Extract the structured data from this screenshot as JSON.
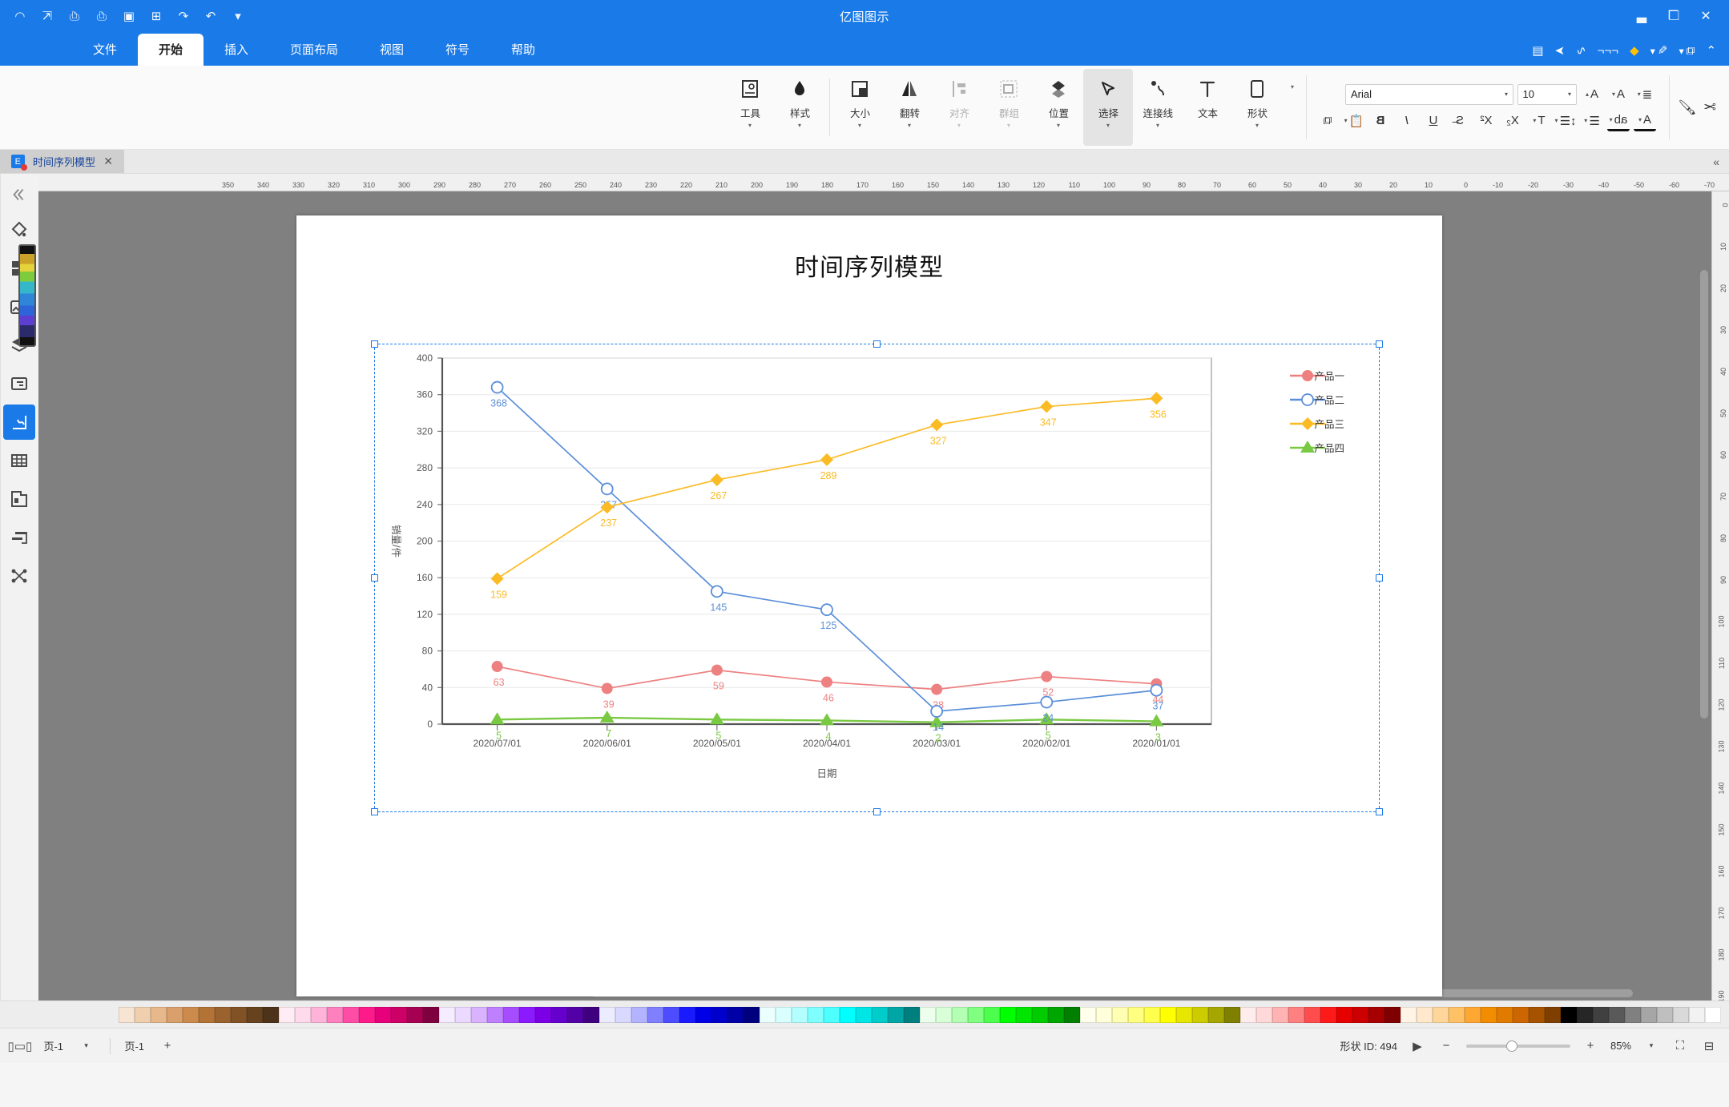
{
  "app": {
    "window_title": "亿图图示",
    "titlebar_icons": [
      "close-icon",
      "restore-icon",
      "minimize-icon"
    ],
    "quick_access_icons": [
      "undo-icon",
      "redo-icon",
      "save-icon",
      "new-icon",
      "open-icon",
      "print-icon",
      "export-icon",
      "more-icon"
    ],
    "quick_toolbar_icons": [
      "select-tool-icon",
      "pen-tool-icon",
      "highlighter-icon",
      "text-tool-icon",
      "connector-icon",
      "pointer-icon",
      "note-icon"
    ]
  },
  "ribbon": {
    "tabs": [
      {
        "label": "文件",
        "active": false
      },
      {
        "label": "开始",
        "active": true
      },
      {
        "label": "插入",
        "active": false
      },
      {
        "label": "页面布局",
        "active": false
      },
      {
        "label": "视图",
        "active": false
      },
      {
        "label": "符号",
        "active": false
      },
      {
        "label": "帮助",
        "active": false
      }
    ],
    "groups": [
      {
        "label": "形状",
        "icon": "shape-icon",
        "active": false,
        "dim": false
      },
      {
        "label": "文本",
        "icon": "text-icon",
        "active": false,
        "dim": false
      },
      {
        "label": "连接线",
        "icon": "connector-icon",
        "active": false,
        "dim": false
      },
      {
        "label": "选择",
        "icon": "select-arrow-icon",
        "active": true,
        "dim": false
      },
      {
        "label": "位置",
        "icon": "position-icon",
        "active": false,
        "dim": false
      },
      {
        "label": "群组",
        "icon": "group-icon",
        "active": false,
        "dim": true
      },
      {
        "label": "对齐",
        "icon": "align-icon",
        "active": false,
        "dim": true
      },
      {
        "label": "翻转",
        "icon": "flip-icon",
        "active": false,
        "dim": false
      },
      {
        "label": "大小",
        "icon": "size-icon",
        "active": false,
        "dim": false
      },
      {
        "label": "样式",
        "icon": "style-icon",
        "active": false,
        "dim": false
      },
      {
        "label": "工具",
        "icon": "tools-icon",
        "active": false,
        "dim": false
      }
    ],
    "font": {
      "family_value": "Arial",
      "size_value": "10",
      "row1_icons": [
        "cut-icon",
        "format-painter-icon",
        "grow-font-icon",
        "shrink-font-icon",
        "text-align-icon"
      ],
      "row2_icons": [
        "copy-icon",
        "paste-icon",
        "bold-icon",
        "italic-icon",
        "underline-icon",
        "strikethrough-icon",
        "superscript-icon",
        "subscript-icon",
        "text-case-icon",
        "line-spacing-icon",
        "bullet-list-icon",
        "highlight-color-icon",
        "font-color-icon"
      ]
    }
  },
  "document_tab": {
    "name": "时间序列模型",
    "icon": "edraw-icon",
    "close_label": "✕",
    "collapse_label": "«"
  },
  "left_rail": {
    "items": [
      {
        "name": "expand-panel",
        "icon": "chevron-right-double-icon",
        "active": false
      },
      {
        "name": "fill-style",
        "icon": "paint-bucket-icon",
        "active": false
      },
      {
        "name": "shape-library",
        "icon": "grid-shapes-icon",
        "active": false
      },
      {
        "name": "image",
        "icon": "picture-icon",
        "active": false
      },
      {
        "name": "layers",
        "icon": "layers-icon",
        "active": false
      },
      {
        "name": "notes",
        "icon": "note-card-icon",
        "active": false
      },
      {
        "name": "chart",
        "icon": "chart-icon",
        "active": true
      },
      {
        "name": "table",
        "icon": "table-icon",
        "active": false
      },
      {
        "name": "floorplan",
        "icon": "floorplan-icon",
        "active": false
      },
      {
        "name": "gantt",
        "icon": "gantt-icon",
        "active": false
      },
      {
        "name": "mindmap",
        "icon": "mindmap-icon",
        "active": false
      }
    ]
  },
  "ruler": {
    "h_ticks": [
      "-70",
      "-60",
      "-50",
      "-40",
      "-30",
      "-20",
      "-10",
      "0",
      "10",
      "20",
      "30",
      "40",
      "50",
      "60",
      "70",
      "80",
      "90",
      "100",
      "110",
      "120",
      "130",
      "140",
      "150",
      "160",
      "170",
      "180",
      "190",
      "200",
      "210",
      "220",
      "230",
      "240",
      "250",
      "260",
      "270",
      "280",
      "290",
      "300",
      "310",
      "320",
      "330",
      "340",
      "350"
    ],
    "v_ticks": [
      "0",
      "10",
      "20",
      "30",
      "40",
      "50",
      "60",
      "70",
      "80",
      "90",
      "100",
      "110",
      "120",
      "130",
      "140",
      "150",
      "160",
      "170",
      "180",
      "190"
    ]
  },
  "status_bar": {
    "shape_id_label": "形状 ID: 494",
    "zoom_value": "85%",
    "page_label": "页-1",
    "page_selector_label": "页-1",
    "add_page_label": "+",
    "minus_label": "−",
    "plus_label": "+",
    "fit_icon": "fit-width-icon",
    "fullscreen_icon": "fullscreen-icon",
    "presentation_icon": "presentation-icon",
    "back-icon": "back-circle-icon"
  },
  "palette": {
    "colors": [
      "#ffffff",
      "#f2f2f2",
      "#d9d9d9",
      "#bfbfbf",
      "#a6a6a6",
      "#808080",
      "#595959",
      "#404040",
      "#262626",
      "#000000",
      "#7f3f00",
      "#a65300",
      "#cc6600",
      "#e07b00",
      "#f28c00",
      "#ffa733",
      "#ffc166",
      "#ffd699",
      "#ffe8cc",
      "#fff4e6",
      "#7f0000",
      "#a60000",
      "#cc0000",
      "#e60000",
      "#ff1a1a",
      "#ff4d4d",
      "#ff8080",
      "#ffb3b3",
      "#ffd9d9",
      "#ffecec",
      "#7f7f00",
      "#a6a600",
      "#cccc00",
      "#e6e600",
      "#ffff00",
      "#ffff4d",
      "#ffff80",
      "#ffffb3",
      "#ffffd9",
      "#ffffec",
      "#007f00",
      "#00a600",
      "#00cc00",
      "#00e600",
      "#00ff00",
      "#4dff4d",
      "#80ff80",
      "#b3ffb3",
      "#d9ffd9",
      "#ecffec",
      "#007f7f",
      "#00a6a6",
      "#00cccc",
      "#00e6e6",
      "#00ffff",
      "#4dffff",
      "#80ffff",
      "#b3ffff",
      "#d9ffff",
      "#ecffff",
      "#00007f",
      "#0000a6",
      "#0000cc",
      "#0000e6",
      "#1a1aff",
      "#4d4dff",
      "#8080ff",
      "#b3b3ff",
      "#d9d9ff",
      "#ececff",
      "#3f007f",
      "#5300a6",
      "#6600cc",
      "#7b00e6",
      "#8c1aff",
      "#a64dff",
      "#bf80ff",
      "#d9b3ff",
      "#ecd9ff",
      "#f5ecff",
      "#7f003f",
      "#a60053",
      "#cc0066",
      "#e6007b",
      "#ff1a8c",
      "#ff4da6",
      "#ff80bf",
      "#ffb3d9",
      "#ffd9ec",
      "#ffecf5",
      "#4d3319",
      "#66421f",
      "#805226",
      "#99622e",
      "#b37336",
      "#cc8a4d",
      "#d9a06b",
      "#e6b88a",
      "#f0cfae",
      "#f7e4d3"
    ]
  },
  "chart_data": {
    "type": "line",
    "title": "时间序列模型",
    "xlabel": "日期",
    "ylabel": "销量/件",
    "grid": true,
    "legend_position": "top-left",
    "ylim": [
      0,
      400
    ],
    "yticks": [
      0,
      40,
      80,
      120,
      160,
      200,
      240,
      280,
      320,
      360,
      400
    ],
    "categories": [
      "2020/01/01",
      "2020/02/01",
      "2020/03/01",
      "2020/04/01",
      "2020/05/01",
      "2020/06/01",
      "2020/07/01"
    ],
    "series": [
      {
        "name": "产品一",
        "color": "#ed8080",
        "marker": "circle-filled",
        "values": [
          44,
          52,
          38,
          46,
          59,
          39,
          63
        ]
      },
      {
        "name": "产品二",
        "color": "#5b8fd9",
        "marker": "circle-hollow",
        "values": [
          37,
          24,
          14,
          125,
          145,
          257,
          368
        ]
      },
      {
        "name": "产品三",
        "color": "#fbbb25",
        "marker": "diamond",
        "values": [
          356,
          347,
          327,
          289,
          267,
          237,
          159
        ]
      },
      {
        "name": "产品四",
        "color": "#7ac943",
        "marker": "triangle",
        "values": [
          3,
          5,
          2,
          4,
          5,
          7,
          5
        ]
      }
    ]
  }
}
